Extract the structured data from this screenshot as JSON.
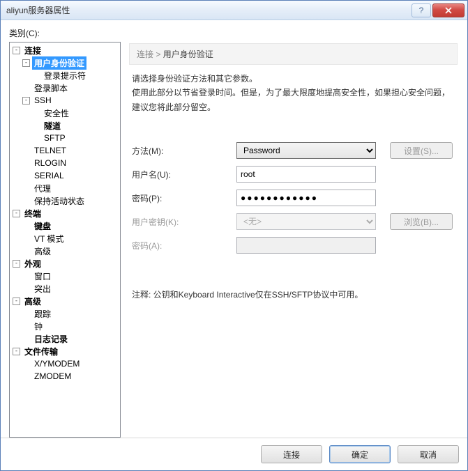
{
  "window": {
    "title": "aliyun服务器属性"
  },
  "category_label": "类别(C):",
  "tree": {
    "connection": "连接",
    "auth": "用户身份验证",
    "login_prompt": "登录提示符",
    "login_script": "登录脚本",
    "ssh": "SSH",
    "security": "安全性",
    "tunnel": "隧道",
    "sftp": "SFTP",
    "telnet": "TELNET",
    "rlogin": "RLOGIN",
    "serial": "SERIAL",
    "proxy": "代理",
    "keepalive": "保持活动状态",
    "terminal": "终端",
    "keyboard": "键盘",
    "vt": "VT 模式",
    "advanced_term": "高级",
    "appearance": "外观",
    "window": "窗口",
    "highlight": "突出",
    "advanced": "高级",
    "trace": "跟踪",
    "bell": "钟",
    "logging": "日志记录",
    "file_transfer": "文件传输",
    "xymodem": "X/YMODEM",
    "zmodem": "ZMODEM"
  },
  "breadcrumb": {
    "root": "连接",
    "sep": " > ",
    "current": "用户身份验证"
  },
  "description": {
    "line1": "请选择身份验证方法和其它参数。",
    "line2": "使用此部分以节省登录时间。但是，为了最大限度地提高安全性，如果担心安全问题，建议您将此部分留空。"
  },
  "form": {
    "method_label": "方法(M):",
    "method_value": "Password",
    "setup_btn": "设置(S)...",
    "username_label": "用户名(U):",
    "username_value": "root",
    "password_label": "密码(P):",
    "password_value": "●●●●●●●●●●●●",
    "userkey_label": "用户密钥(K):",
    "userkey_value": "<无>",
    "browse_btn": "浏览(B)...",
    "passphrase_label": "密码(A):"
  },
  "note": "注释: 公钥和Keyboard Interactive仅在SSH/SFTP协议中可用。",
  "footer": {
    "connect": "连接",
    "ok": "确定",
    "cancel": "取消"
  }
}
